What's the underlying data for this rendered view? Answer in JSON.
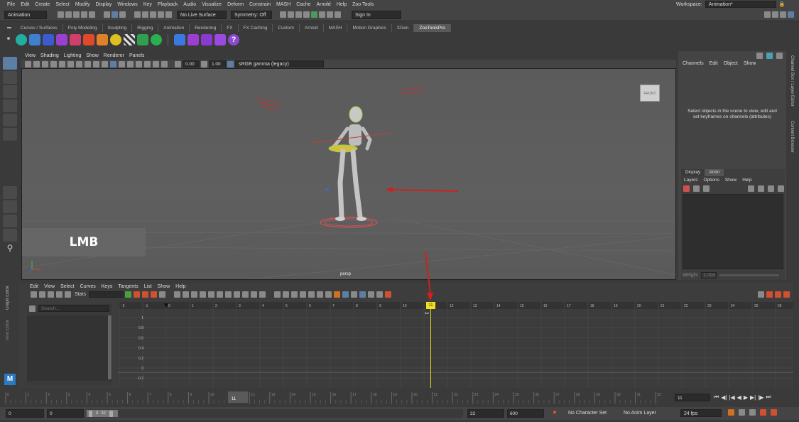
{
  "menu": [
    "File",
    "Edit",
    "Create",
    "Select",
    "Modify",
    "Display",
    "Windows",
    "Key",
    "Playback",
    "Audio",
    "Visualize",
    "Deform",
    "Constrain",
    "MASH",
    "Cache",
    "Arnold",
    "Help",
    "Zoo Tools"
  ],
  "workspace": {
    "label": "Workspace:",
    "value": "Animation*"
  },
  "status": {
    "mode": "Animation",
    "live_surface": "No Live Surface",
    "symmetry": "Symmetry: Off",
    "sign_in": "Sign In"
  },
  "shelf_tabs": [
    "Curves / Surfaces",
    "Poly Modeling",
    "Sculpting",
    "Rigging",
    "Animation",
    "Rendering",
    "FX",
    "FX Caching",
    "Custom",
    "Arnold",
    "MASH",
    "Motion Graphics",
    "XGen",
    "ZooToolsPro"
  ],
  "shelf_active": "ZooToolsPro",
  "panel_menu": [
    "View",
    "Shading",
    "Lighting",
    "Show",
    "Renderer",
    "Panels"
  ],
  "viewport_toolbar": {
    "exposure": "0.00",
    "gamma": "1.00",
    "colorspace": "sRGB gamma (legacy)"
  },
  "viewport": {
    "camera": "persp",
    "cube": "FRONT",
    "overlay": "LMB"
  },
  "channel_box": {
    "tabs": [
      "Channels",
      "Edit",
      "Object",
      "Show"
    ],
    "message": "Select objects in the scene to view, edit and set keyframes on channels (attributes)"
  },
  "side_tabs": [
    "Channel Box / Layer Editor",
    "Content Browser"
  ],
  "layer_editor": {
    "tabs": [
      "Display",
      "Anim"
    ],
    "active_tab": "Anim",
    "menus": [
      "Layers",
      "Options",
      "Show",
      "Help"
    ],
    "weight_label": "Weight",
    "weight_value": "1.000"
  },
  "graph_editor": {
    "title": "Graph Editor",
    "menu": [
      "Edit",
      "View",
      "Select",
      "Curves",
      "Keys",
      "Tangents",
      "List",
      "Show",
      "Help"
    ],
    "stats_label": "Stats",
    "search_placeholder": "Search...",
    "vlabels": [
      "1",
      "0.8",
      "0.6",
      "0.4",
      "0.2",
      "0",
      "-0.2"
    ],
    "frames": [
      "-2",
      "-1",
      "0",
      "1",
      "2",
      "3",
      "4",
      "5",
      "6",
      "7",
      "8",
      "9",
      "10",
      "11",
      "12",
      "13",
      "14",
      "15",
      "16",
      "17",
      "18",
      "19",
      "20",
      "21",
      "22",
      "23",
      "24",
      "25",
      "26"
    ],
    "current_frame": "11",
    "vertical_tab": "Time Editor"
  },
  "timeline": {
    "ticks": [
      "0",
      "1",
      "2",
      "3",
      "4",
      "5",
      "6",
      "7",
      "8",
      "9",
      "10",
      "11",
      "12",
      "13",
      "14",
      "15",
      "16",
      "17",
      "18",
      "19",
      "20",
      "21",
      "22",
      "23",
      "24",
      "25",
      "26",
      "27",
      "28",
      "29",
      "30",
      "31",
      "32"
    ],
    "current": "11"
  },
  "range": {
    "start": "0",
    "playback_start": "0",
    "range_min": "0",
    "range_max": "32",
    "playback_end": "32",
    "end": "600",
    "character_set": "No Character Set",
    "anim_layer": "No Anim Layer",
    "fps": "24 fps"
  }
}
